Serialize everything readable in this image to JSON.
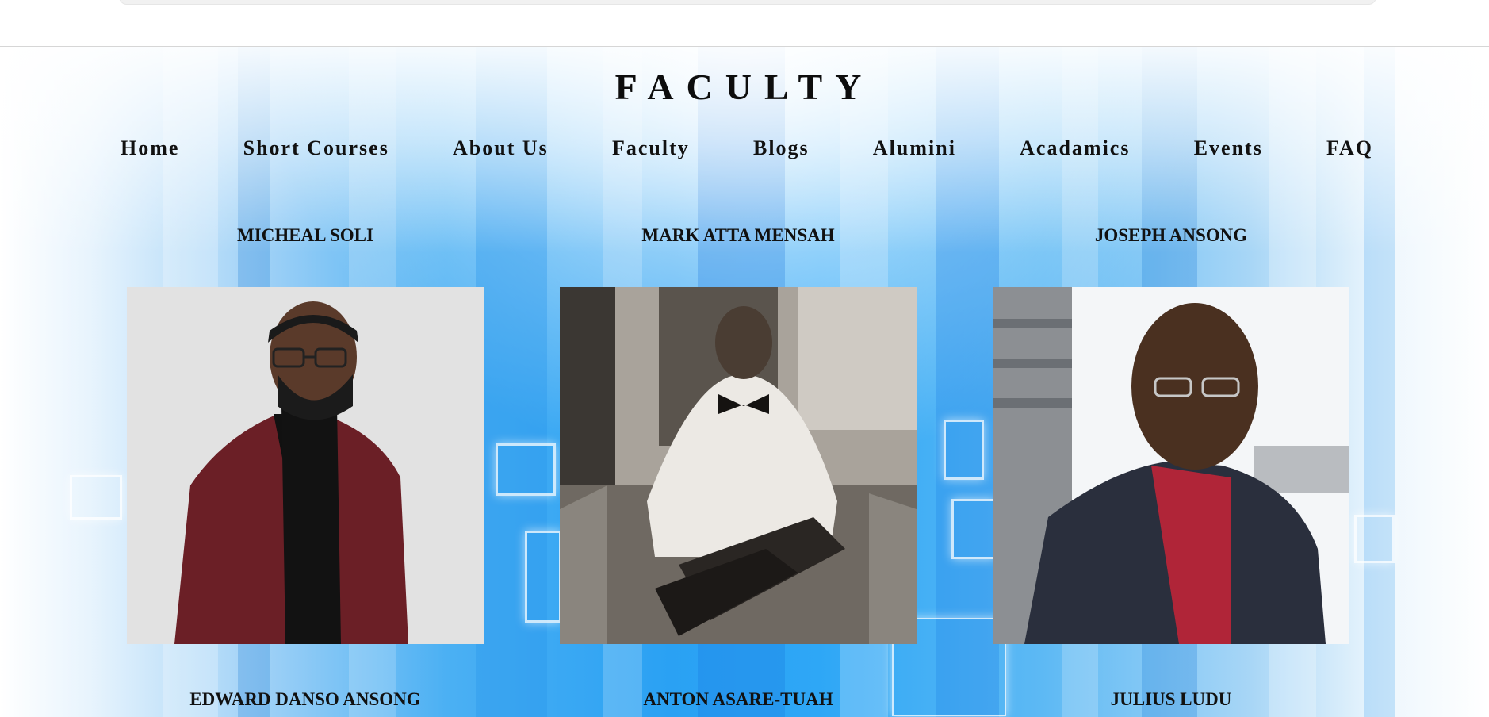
{
  "page": {
    "title": "FACULTY"
  },
  "nav": {
    "items": [
      "Home",
      "Short Courses",
      "About Us",
      "Faculty",
      "Blogs",
      "Alumini",
      "Acadamics",
      "Events",
      "FAQ"
    ]
  },
  "faculty": {
    "row1": [
      {
        "name": "MICHEAL SOLI"
      },
      {
        "name": "MARK ATTA MENSAH"
      },
      {
        "name": "JOSEPH ANSONG"
      }
    ],
    "row2": [
      {
        "name": "EDWARD DANSO ANSONG"
      },
      {
        "name": "ANTON ASARE-TUAH"
      },
      {
        "name": "JULIUS LUDU"
      }
    ]
  },
  "colors": {
    "background_blue": "#2aa1f3",
    "text": "#111111"
  }
}
